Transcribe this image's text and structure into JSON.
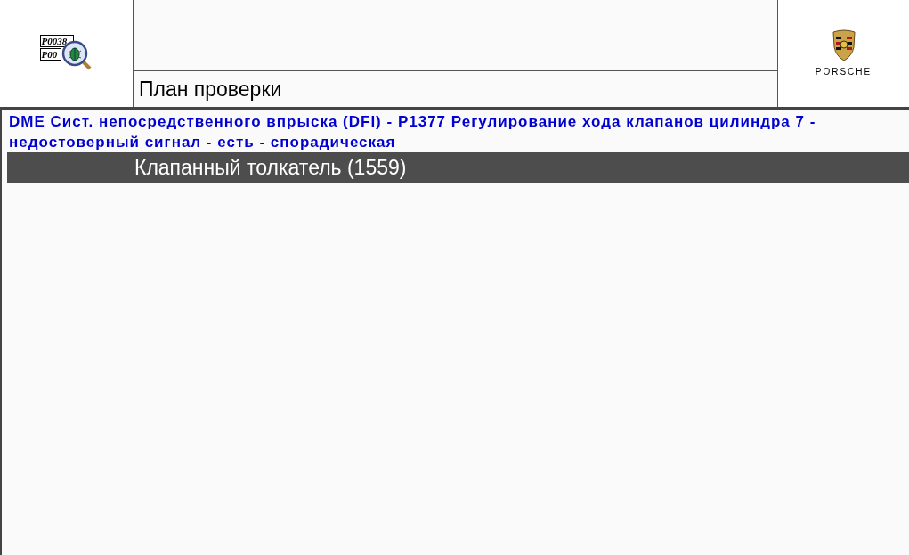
{
  "header": {
    "app_icon_codes": [
      "P0038",
      "P00"
    ],
    "title": "План проверки",
    "brand": "PORSCHE"
  },
  "fault": {
    "description": "DME Сист. непосредственного впрыска (DFI) - P1377 Регулирование хода клапанов цилиндра 7 - недостоверный сигнал - есть - спорадическая"
  },
  "test_steps": [
    {
      "label": "Клапанный толкатель (1559)",
      "selected": true
    }
  ]
}
